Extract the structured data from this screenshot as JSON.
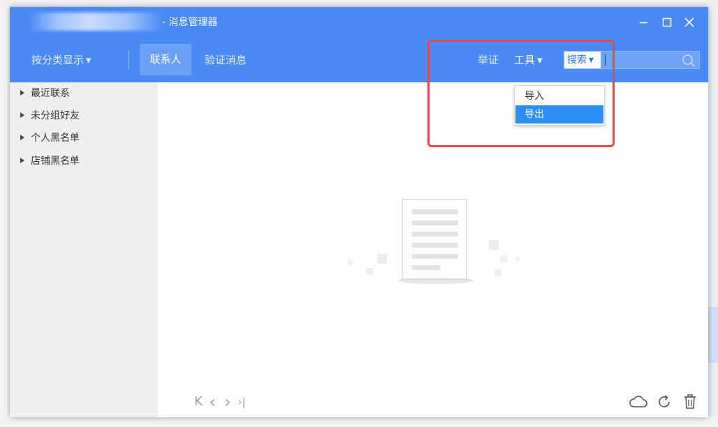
{
  "window": {
    "title": "- 消息管理器",
    "controls": [
      "minimize-icon",
      "maximize-icon",
      "close-icon"
    ]
  },
  "toolbar": {
    "view_mode": "按分类显示",
    "view_mode_arrow": "▾",
    "tabs": [
      {
        "label": "联系人",
        "active": true
      },
      {
        "label": "验证消息",
        "active": false
      }
    ],
    "report": "举证",
    "tools": "工具",
    "tools_arrow": "▾"
  },
  "search": {
    "type_label": "搜索",
    "type_arrow": "▾",
    "placeholder": "",
    "icon": "search-icon"
  },
  "tools_menu": {
    "items": [
      {
        "label": "导入",
        "highlighted": false
      },
      {
        "label": "导出",
        "highlighted": true
      }
    ]
  },
  "sidebar": {
    "items": [
      {
        "label": "最近联系"
      },
      {
        "label": "未分组好友"
      },
      {
        "label": "个人黑名单"
      },
      {
        "label": "店铺黑名单"
      }
    ]
  },
  "pager": {
    "first": "K",
    "prev": "‹",
    "next": "›",
    "last": "›|"
  },
  "bottom_icons": [
    "cloud-icon",
    "refresh-icon",
    "trash-icon"
  ],
  "colors": {
    "titlebar": "#4a8af4",
    "active_tab": "#6aa0f6",
    "menu_highlight": "#2b8ef0",
    "annotation_box": "#e8484b",
    "sidebar_bg": "#efefef"
  }
}
